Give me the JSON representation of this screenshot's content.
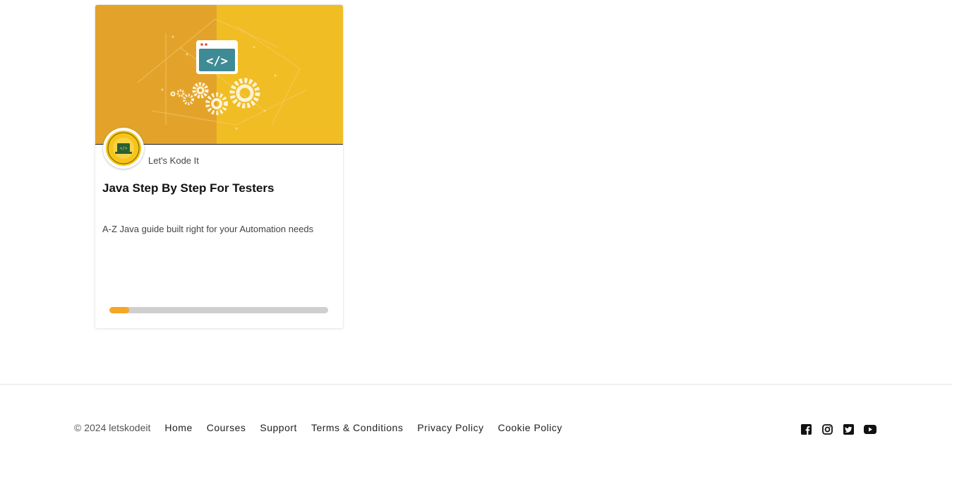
{
  "course": {
    "author": "Let's Kode It",
    "title": "Java Step By Step For Testers",
    "description": "A-Z Java guide built right for your Automation needs",
    "progress_percent": 9,
    "thumbnail_icon": "code-window-gears-icon",
    "colors": {
      "thumb_left": "#e3a32b",
      "thumb_right": "#f0bd24",
      "progress": "#f5a623",
      "track": "#cfcfcf"
    }
  },
  "footer": {
    "copyright": "© 2024 letskodeit",
    "links": [
      "Home",
      "Courses",
      "Support",
      "Terms & Conditions",
      "Privacy Policy",
      "Cookie Policy"
    ],
    "social": [
      "facebook-icon",
      "instagram-icon",
      "twitter-icon",
      "youtube-icon"
    ]
  }
}
